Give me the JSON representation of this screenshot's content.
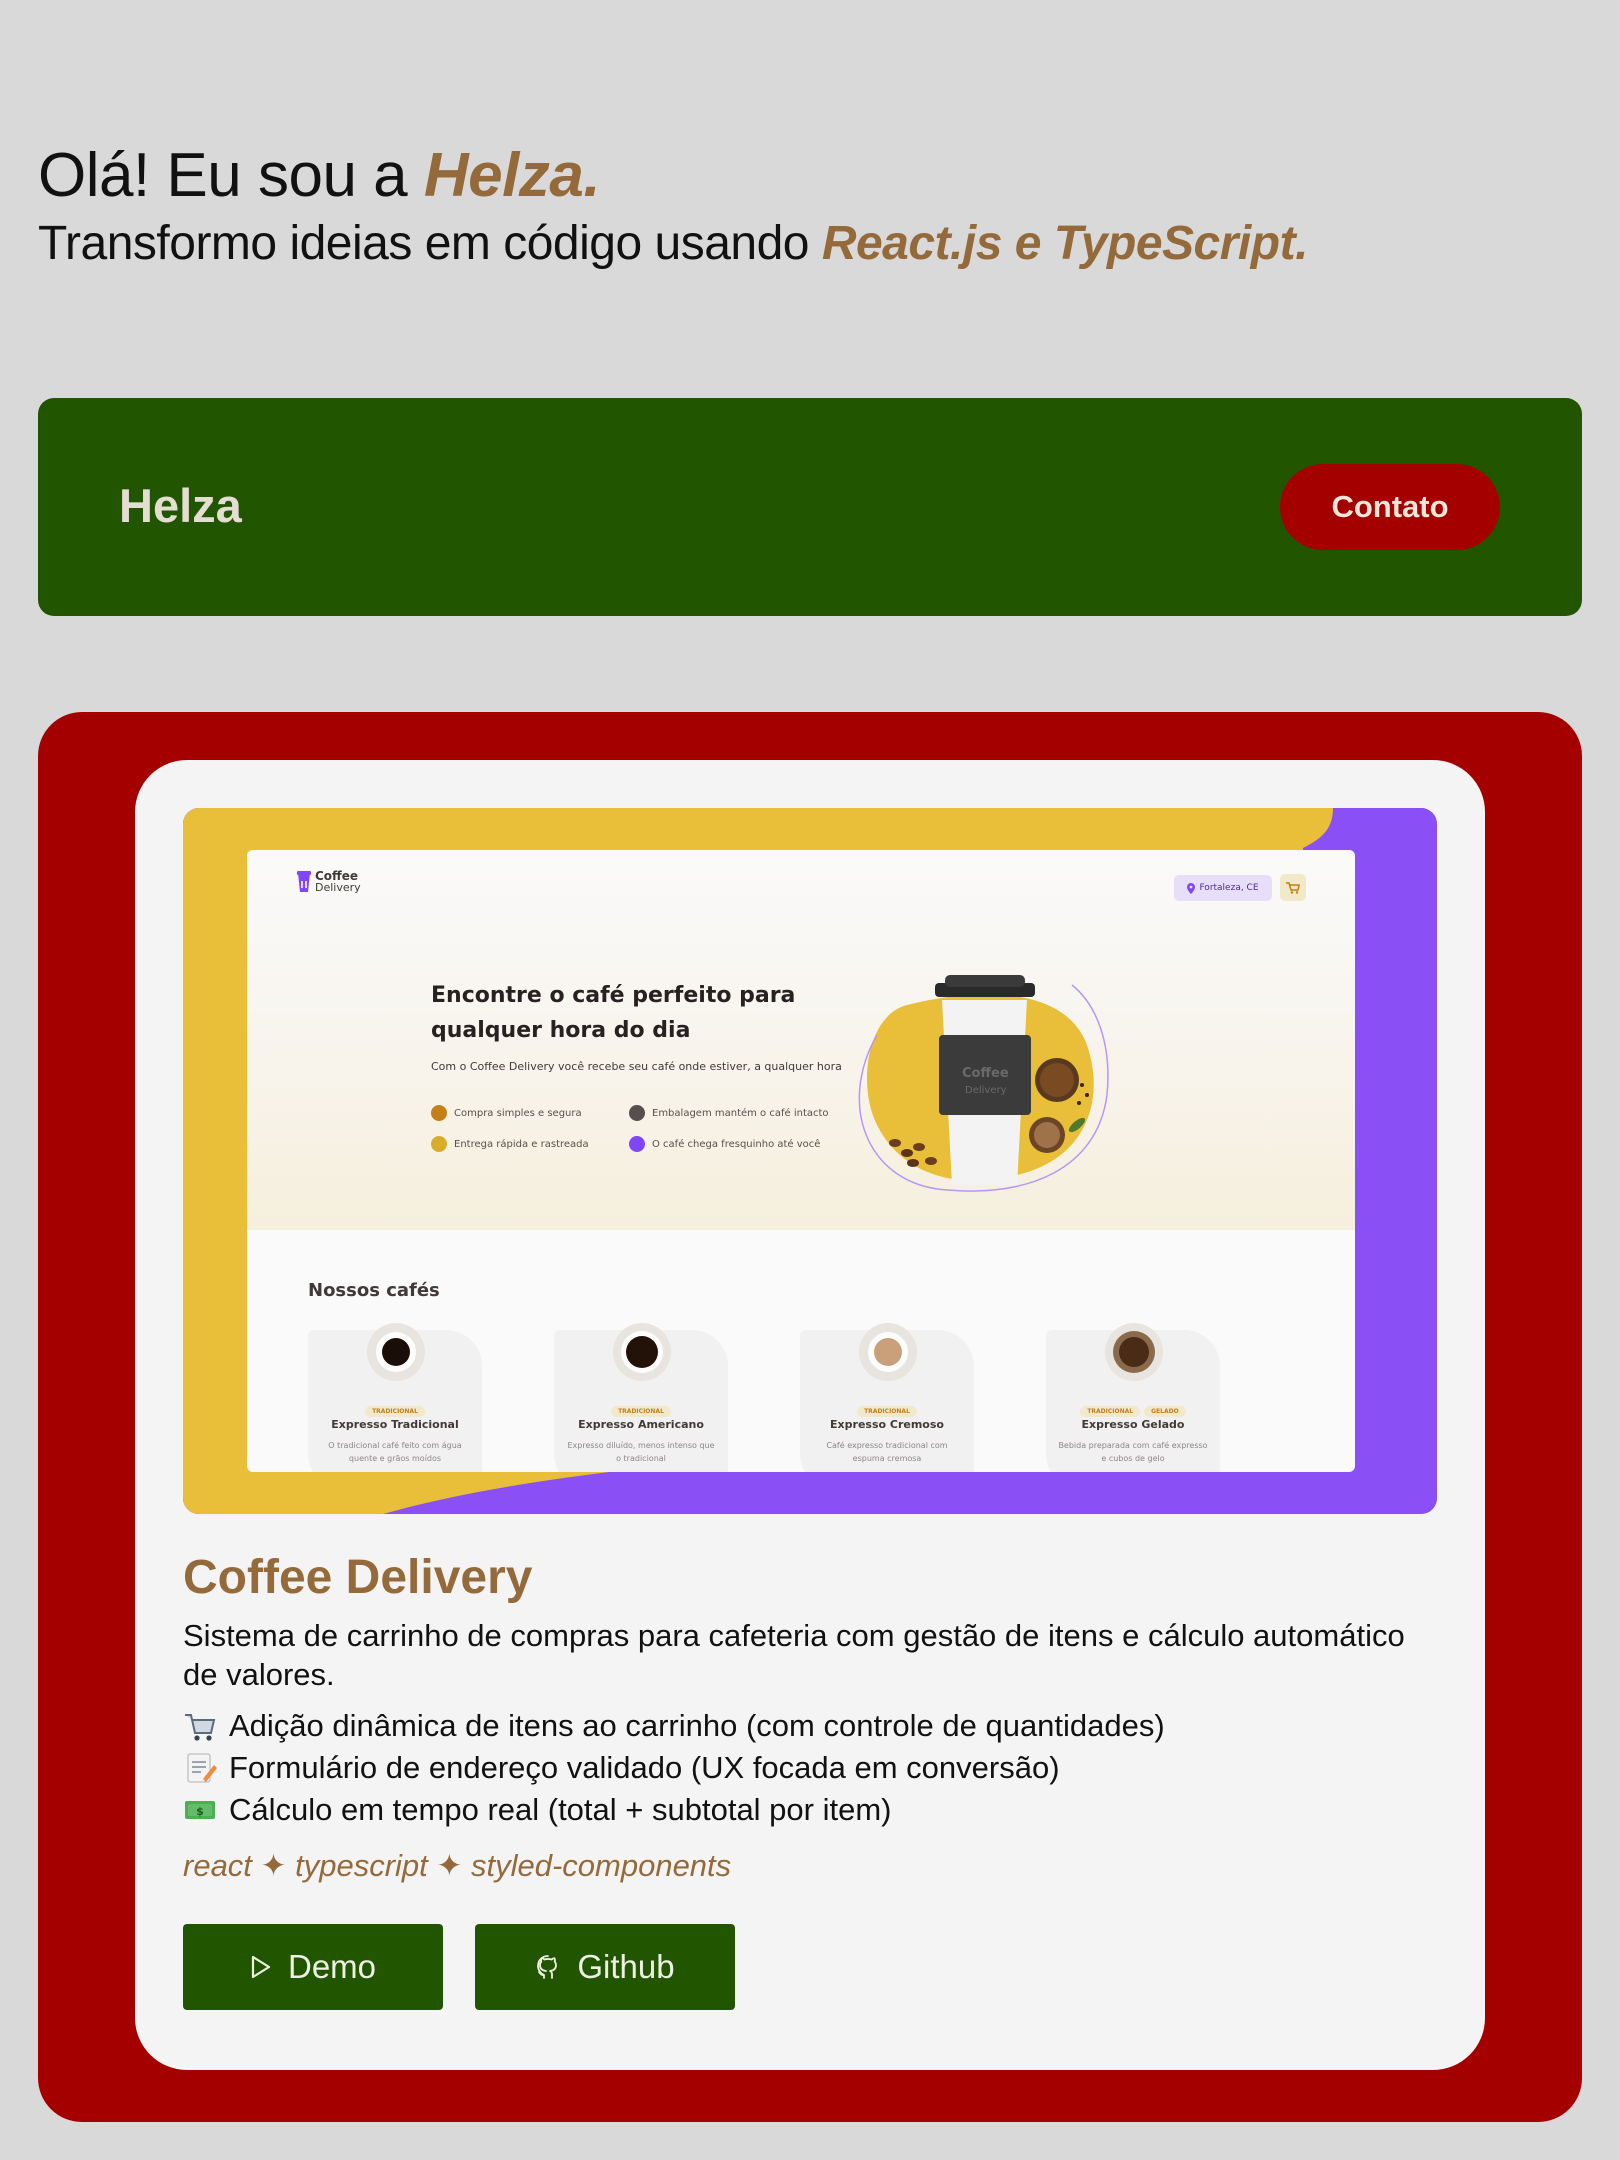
{
  "hero": {
    "greeting_prefix": "Olá! Eu sou a ",
    "name": "Helza.",
    "tagline_prefix": "Transformo ideias em código usando ",
    "tagline_accent": "React.js e TypeScript."
  },
  "navbar": {
    "brand": "Helza",
    "contact_label": "Contato"
  },
  "project": {
    "title": "Coffee Delivery",
    "description": "Sistema de carrinho de compras para cafeteria com gestão de itens e cálculo automático de valores.",
    "features": [
      {
        "icon": "shopping-cart-icon",
        "text": "Adição dinâmica de itens ao carrinho (com controle de quantidades)"
      },
      {
        "icon": "memo-icon",
        "text": "Formulário de endereço validado (UX focada em conversão)"
      },
      {
        "icon": "money-icon",
        "text": "Cálculo em tempo real (total + subtotal por item)"
      }
    ],
    "stack": "react ✦ typescript ✦ styled-components",
    "demo_label": "Demo",
    "github_label": "Github",
    "preview": {
      "logo_line1": "Coffee",
      "logo_line2": "Delivery",
      "location": "Fortaleza, CE",
      "headline": "Encontre o café perfeito para qualquer hora do dia",
      "subheadline": "Com o Coffee Delivery você recebe seu café onde estiver, a qualquer hora",
      "features": [
        "Compra simples e segura",
        "Embalagem mantém o café intacto",
        "Entrega rápida e rastreada",
        "O café chega fresquinho até você"
      ],
      "section_title": "Nossos cafés",
      "coffees": [
        {
          "tags": [
            "TRADICIONAL"
          ],
          "name": "Expresso Tradicional",
          "desc": "O tradicional café feito com água quente e grãos moídos"
        },
        {
          "tags": [
            "TRADICIONAL"
          ],
          "name": "Expresso Americano",
          "desc": "Expresso diluído, menos intenso que o tradicional"
        },
        {
          "tags": [
            "TRADICIONAL"
          ],
          "name": "Expresso Cremoso",
          "desc": "Café expresso tradicional com espuma cremosa"
        },
        {
          "tags": [
            "TRADICIONAL",
            "GELADO"
          ],
          "name": "Expresso Gelado",
          "desc": "Bebida preparada com café expresso e cubos de gelo"
        }
      ]
    }
  },
  "colors": {
    "background": "#d9d9d9",
    "accent": "#956a3a",
    "green": "#215500",
    "red": "#a50000",
    "preview_yellow": "#e9bf3a",
    "preview_purple": "#8a4ff5"
  }
}
